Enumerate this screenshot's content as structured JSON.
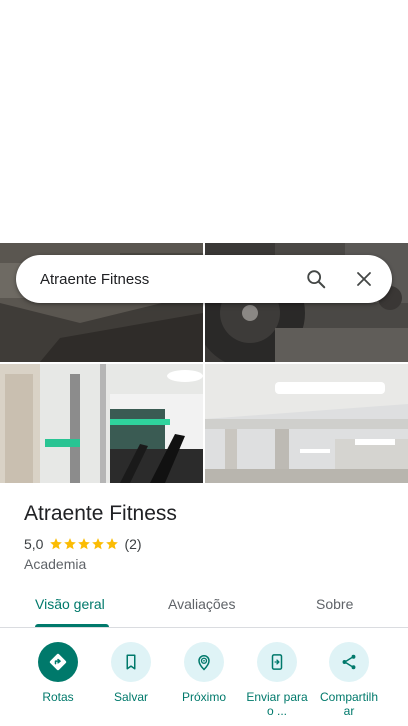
{
  "search": {
    "query": "Atraente Fitness"
  },
  "place": {
    "name": "Atraente Fitness",
    "rating_value": "5,0",
    "stars": 5,
    "review_count": "(2)",
    "category": "Academia"
  },
  "tabs": [
    {
      "label": "Visão geral",
      "active": true
    },
    {
      "label": "Avaliações",
      "active": false
    },
    {
      "label": "Sobre",
      "active": false
    }
  ],
  "actions": [
    {
      "label": "Rotas",
      "icon": "directions-icon"
    },
    {
      "label": "Salvar",
      "icon": "bookmark-icon"
    },
    {
      "label": "Próximo",
      "icon": "nearby-icon"
    },
    {
      "label": "Enviar para o ...",
      "icon": "send-to-phone-icon"
    },
    {
      "label": "Compartilhar",
      "icon": "share-icon"
    }
  ],
  "colors": {
    "accent": "#00796b",
    "action_bg": "#dff3f6",
    "star": "#fbbc04"
  }
}
